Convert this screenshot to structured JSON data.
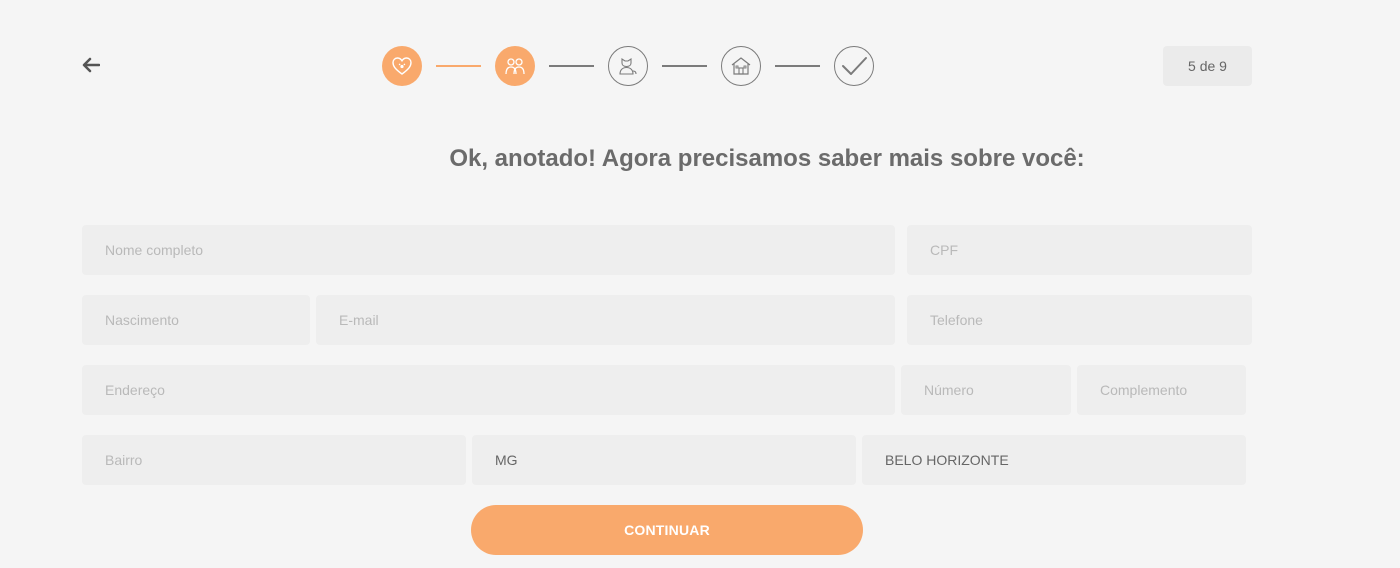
{
  "colors": {
    "accent": "#f9a96c",
    "background": "#f5f5f5",
    "field": "#eeeeee",
    "muted": "#7b7b7b"
  },
  "nav": {
    "back_icon": "arrow-left-icon"
  },
  "stepper": {
    "steps": [
      {
        "icon": "heart-paw-icon",
        "state": "done"
      },
      {
        "icon": "people-icon",
        "state": "done"
      },
      {
        "icon": "pets-icon",
        "state": "pending"
      },
      {
        "icon": "house-icon",
        "state": "pending"
      },
      {
        "icon": "check-icon",
        "state": "pending"
      }
    ],
    "counter": "5 de 9"
  },
  "title": "Ok, anotado! Agora precisamos saber mais sobre você:",
  "form": {
    "nome": {
      "placeholder": "Nome completo",
      "value": ""
    },
    "cpf": {
      "placeholder": "CPF",
      "value": ""
    },
    "nascimento": {
      "placeholder": "Nascimento",
      "value": ""
    },
    "email": {
      "placeholder": "E-mail",
      "value": ""
    },
    "telefone": {
      "placeholder": "Telefone",
      "value": ""
    },
    "endereco": {
      "placeholder": "Endereço",
      "value": ""
    },
    "numero": {
      "placeholder": "Número",
      "value": ""
    },
    "complemento": {
      "placeholder": "Complemento",
      "value": ""
    },
    "bairro": {
      "placeholder": "Bairro",
      "value": ""
    },
    "estado": {
      "value": "MG"
    },
    "cidade": {
      "value": "BELO HORIZONTE"
    }
  },
  "submit_label": "CONTINUAR"
}
